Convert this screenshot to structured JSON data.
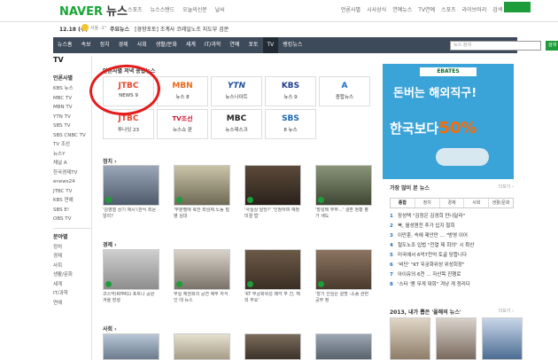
{
  "top": {
    "logo": "NAVER",
    "logo_news": "뉴스",
    "nav": [
      "스포츠",
      "뉴스스탠드",
      "오늘의신문",
      "날씨"
    ],
    "right": [
      "언론사별",
      "시사상식",
      "연예뉴스",
      "TV연예",
      "스포츠",
      "라이브러리",
      "검색"
    ],
    "green_button": ""
  },
  "weather": {
    "date": "12.18 (수)",
    "temp": "서울 -1°",
    "issue_label": "주요뉴스",
    "issue_text": "[경향포토] 조계사 코레일노조 지도부 검문"
  },
  "nav": {
    "items": [
      "뉴스홈",
      "속보",
      "정치",
      "경제",
      "사회",
      "생활/문화",
      "세계",
      "IT/과학",
      "연예",
      "포토",
      "TV",
      "랭킹뉴스"
    ],
    "active_index": 10,
    "search_placeholder": "뉴스 검색",
    "search_button": "검색"
  },
  "sidebar": {
    "head": "TV",
    "sub1": "언론사별",
    "links1": [
      "KBS 뉴스",
      "MBC TV",
      "MBN TV",
      "YTN TV",
      "SBS TV",
      "SBS CNBC TV",
      "TV 조선",
      "뉴스Y",
      "채널 A",
      "한국경제TV",
      "enews24",
      "JTBC TV",
      "KBS 연예",
      "SBS E!",
      "OBS TV"
    ],
    "sub2": "분야별",
    "links2": [
      "정치",
      "경제",
      "사회",
      "생활/문화",
      "세계",
      "IT/과학",
      "연예"
    ]
  },
  "main": {
    "brand_title": "언론사별 저녁 종합뉴스",
    "brands": [
      {
        "logo": "JTBC",
        "name": "NEWS 9",
        "color": "#e8442c"
      },
      {
        "logo": "MBN",
        "name": "뉴스 8",
        "color": "#e96a1a"
      },
      {
        "logo": "YTN",
        "name": "뉴스나이트",
        "color": "#1b4e9b"
      },
      {
        "logo": "KBS",
        "name": "뉴스 9",
        "color": "#1d3d8f"
      },
      {
        "logo": "A",
        "name": "종합뉴스",
        "color": "#1d6fc9"
      },
      {
        "logo": "JTBC",
        "name": "투나잇 23",
        "color": "#e8442c"
      },
      {
        "logo": "TV조선",
        "name": "뉴스쇼 판",
        "color": "#c8102e"
      },
      {
        "logo": "MBC",
        "name": "뉴스데스크",
        "color": "#222222"
      },
      {
        "logo": "SBS",
        "name": "8 뉴스",
        "color": "#1766b3"
      }
    ],
    "politics_title": "정치 ›",
    "politics": [
      {
        "cap": "'김영철 상기 제시'(관식 최문 알리?"
      },
      {
        "cap": "'무분별에 북한 최임제 노동 질병 심대"
      },
      {
        "cap": "'사실상 탈당?' '인정하며 예정 미결 법'"
      },
      {
        "cap": "'장성택 부부...' 결혼 정황 평가 새도"
      }
    ],
    "economy_title": "경제 ›",
    "economy": [
      {
        "cap": "코스닥(KPMG) 포트나 공원 겨울 장설"
      },
      {
        "cap": "부실 채권회의 공연 채무 자식인 데 뉴스"
      },
      {
        "cap": "'KT 무궁화위성 매각 무 건, 해외 주요'"
      },
      {
        "cap": "'장기 선임은 설명 -소송 관련 공부 정"
      }
    ],
    "society_title": "사회 ›"
  },
  "ad": {
    "brand": "EBATES",
    "headline": "돈버는 해외직구!",
    "sub": "한국보다",
    "pct": "50%"
  },
  "rank": {
    "title": "가장 많이 본 뉴스",
    "more": "더보기 ›",
    "tabs": [
      "종합",
      "정치",
      "경제",
      "사회",
      "생활/문화"
    ],
    "items": [
      "장성택 \"김정은 김경희 만나달라\"",
      "북, 월성원전 추가 입지 철회",
      "이만훈, 속에 제안만 ... \"방영 이어",
      "철도노조 입법 \"전열 제 회의\" 시 확산",
      "미국에서 6억7천억 토굴 당합니다",
      "'비단' \"KT 무궁화위성 위성회장\"",
      "아이유의 6천 ... 자산목 진행로",
      "'스타 '몸 무게 대회\" 겨냥 게 정리다"
    ]
  },
  "best": {
    "title": "2013, 내가 뽑은 '올해의 뉴스'",
    "more": "더보기 ›"
  }
}
